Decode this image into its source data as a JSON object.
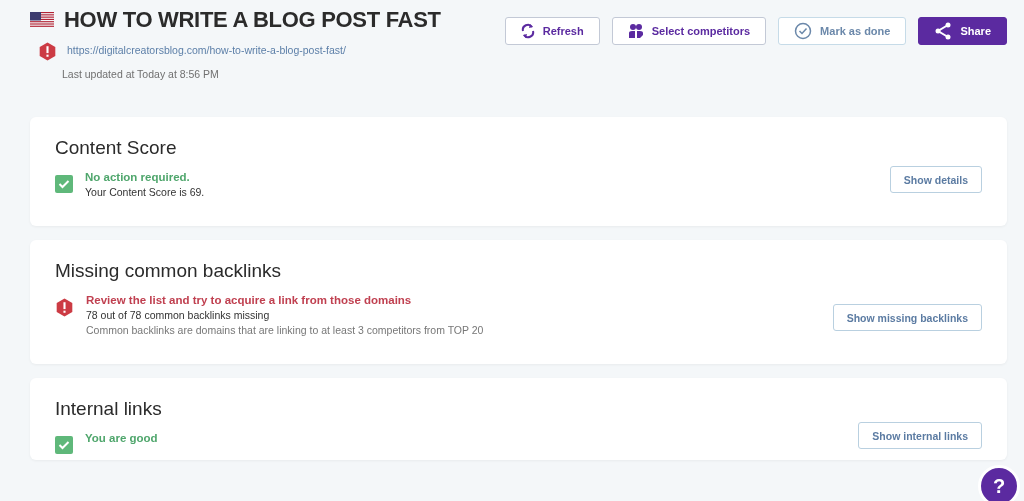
{
  "header": {
    "title": "HOW TO WRITE A BLOG POST FAST",
    "url": "https://digitalcreatorsblog.com/how-to-write-a-blog-post-fast/",
    "updated": "Last updated at Today at 8:56 PM"
  },
  "actions": [
    {
      "label": "Refresh",
      "kind": "refresh"
    },
    {
      "label": "Select competitors",
      "kind": "competitors"
    },
    {
      "label": "Mark as done",
      "kind": "done"
    },
    {
      "label": "Share",
      "kind": "share"
    }
  ],
  "sections": [
    {
      "title": "Content Score",
      "kind": "ok",
      "headline": "No action required.",
      "lines": [
        "Your Content Score is 69."
      ],
      "button": "Show details"
    },
    {
      "title": "Missing common backlinks",
      "kind": "error",
      "headline": "Review the list and try to acquire a link from those domains",
      "lines": [
        "78 out of 78 common backlinks missing",
        "Common backlinks are domains that are linking to at least 3 competitors from TOP 20"
      ],
      "button": "Show missing backlinks"
    },
    {
      "title": "Internal links",
      "kind": "ok",
      "headline": "You are good",
      "button": "Show internal links"
    }
  ],
  "help": {
    "label": "?"
  }
}
